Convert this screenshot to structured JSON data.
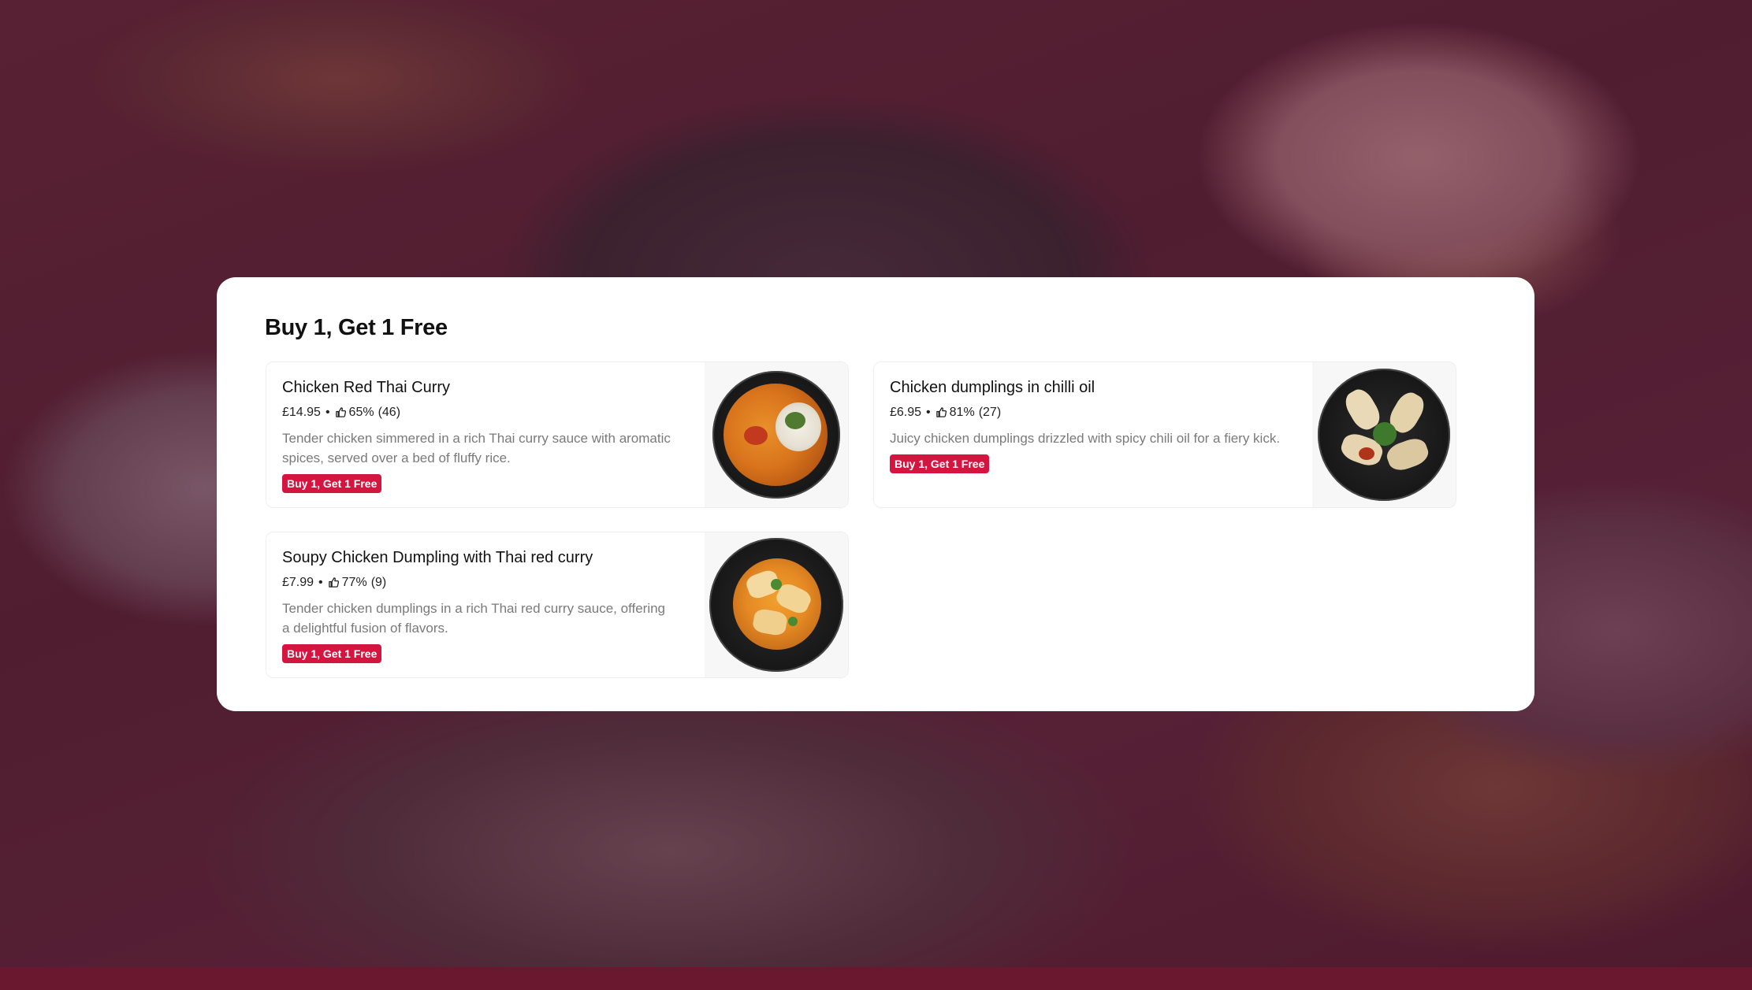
{
  "section": {
    "title": "Buy 1, Get 1 Free"
  },
  "items": [
    {
      "name": "Chicken Red Thai Curry",
      "price": "£14.95",
      "rating": "65%",
      "reviews": "(46)",
      "description": "Tender chicken simmered in a rich Thai curry sauce with aromatic spices, served over a bed of fluffy rice.",
      "badge": "Buy 1, Get 1 Free"
    },
    {
      "name": "Chicken dumplings in chilli oil",
      "price": "£6.95",
      "rating": "81%",
      "reviews": "(27)",
      "description": "Juicy chicken dumplings drizzled with spicy chili oil for a fiery kick.",
      "badge": "Buy 1, Get 1 Free"
    },
    {
      "name": "Soupy Chicken Dumpling with Thai red curry",
      "price": "£7.99",
      "rating": "77%",
      "reviews": "(9)",
      "description": "Tender chicken dumplings in a rich Thai red curry sauce, offering a delightful fusion of flavors.",
      "badge": "Buy 1, Get 1 Free"
    }
  ],
  "meta_separator": "•",
  "icons": {
    "rating": "thumbs-up-icon"
  },
  "colors": {
    "badge": "#d41540",
    "background_tint": "#5a142d",
    "bottom_bar": "#6a1830"
  }
}
